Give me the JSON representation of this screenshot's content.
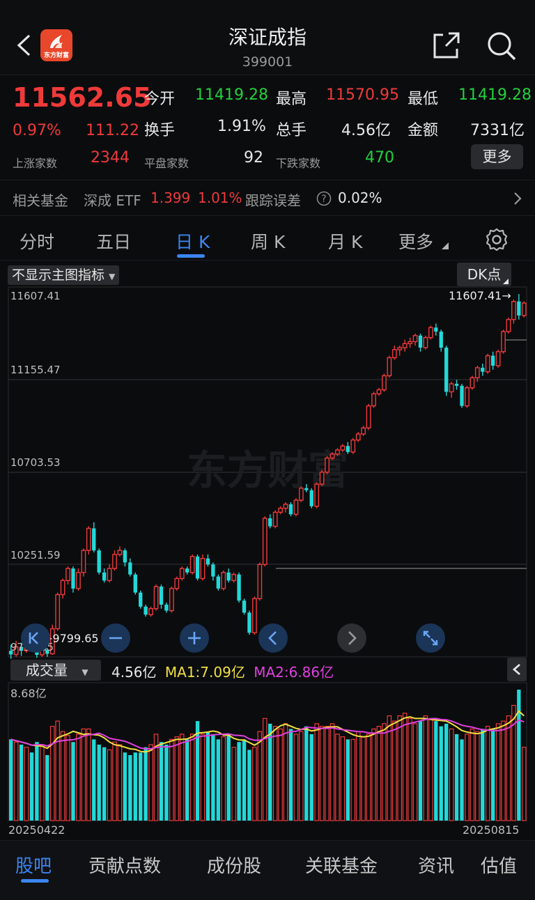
{
  "header": {
    "title": "深证成指",
    "code": "399001",
    "logo_text": "东方财富"
  },
  "quote": {
    "price": "11562.65",
    "change_pct": "0.97%",
    "change_abs": "111.22",
    "open_label": "今开",
    "open": "11419.28",
    "high_label": "最高",
    "high": "11570.95",
    "low_label": "最低",
    "low": "11419.28",
    "turnover_label": "换手",
    "turnover": "1.91%",
    "volume_label": "总手",
    "volume": "4.56亿",
    "amount_label": "金额",
    "amount": "7331亿",
    "up_label": "上涨家数",
    "up": "2344",
    "flat_label": "平盘家数",
    "flat": "92",
    "down_label": "下跌家数",
    "down": "470",
    "more_label": "更多"
  },
  "fund": {
    "label": "相关基金",
    "name": "深成 ETF",
    "price": "1.399",
    "pct": "1.01%",
    "error_label": "跟踪误差",
    "error": "0.02%"
  },
  "tabs": [
    {
      "label": "分时"
    },
    {
      "label": "五日"
    },
    {
      "label": "日 K"
    },
    {
      "label": "周 K"
    },
    {
      "label": "月 K"
    },
    {
      "label": "更多"
    }
  ],
  "chart": {
    "indicator_dropdown": "不显示主图指标",
    "dk_button": "DK点",
    "watermark": "东方财富",
    "y_labels": [
      "11607.41",
      "11155.47",
      "10703.53",
      "10251.59",
      "9799.65"
    ],
    "max_marker": "11607.41",
    "min_marker": "9799.65"
  },
  "volume": {
    "dropdown": "成交量",
    "value": "4.56亿",
    "ma1": "MA1:7.09亿",
    "ma2": "MA2:6.86亿",
    "max_label": "8.68亿",
    "start_date": "20250422",
    "end_date": "20250815"
  },
  "bottom_nav": [
    {
      "label": "股吧"
    },
    {
      "label": "贡献点数"
    },
    {
      "label": "成份股"
    },
    {
      "label": "关联基金"
    },
    {
      "label": "资讯"
    },
    {
      "label": "估值"
    }
  ],
  "colors": {
    "up": "#f03a3a",
    "down": "#23d8d8",
    "accent": "#3a86f0",
    "ma1": "#f0e040",
    "ma2": "#e040e0"
  },
  "chart_data": {
    "type": "candlestick",
    "y_range": [
      9799.65,
      11607.41
    ],
    "candles": [
      [
        9830,
        9812,
        9860,
        9790
      ],
      [
        9812,
        9850,
        9880,
        9800
      ],
      [
        9850,
        9830,
        9870,
        9805
      ],
      [
        9830,
        9900,
        9915,
        9820
      ],
      [
        9900,
        9860,
        9920,
        9840
      ],
      [
        9860,
        9810,
        9880,
        9795
      ],
      [
        9810,
        9835,
        9850,
        9800
      ],
      [
        9835,
        9815,
        9845,
        9800
      ],
      [
        9815,
        9940,
        9960,
        9810
      ],
      [
        9940,
        10110,
        10120,
        9930
      ],
      [
        10110,
        10180,
        10190,
        10090
      ],
      [
        10180,
        10240,
        10250,
        10160
      ],
      [
        10240,
        10140,
        10250,
        10120
      ],
      [
        10140,
        10220,
        10240,
        10130
      ],
      [
        10220,
        10330,
        10340,
        10200
      ],
      [
        10330,
        10440,
        10450,
        10310
      ],
      [
        10440,
        10330,
        10470,
        10320
      ],
      [
        10330,
        10220,
        10340,
        10210
      ],
      [
        10220,
        10180,
        10240,
        10170
      ],
      [
        10180,
        10240,
        10260,
        10170
      ],
      [
        10240,
        10310,
        10330,
        10230
      ],
      [
        10310,
        10330,
        10350,
        10300
      ],
      [
        10330,
        10270,
        10340,
        10250
      ],
      [
        10270,
        10210,
        10290,
        10200
      ],
      [
        10210,
        10120,
        10220,
        10110
      ],
      [
        10120,
        10050,
        10130,
        10040
      ],
      [
        10050,
        10010,
        10060,
        10000
      ],
      [
        10010,
        10040,
        10050,
        10000
      ],
      [
        10040,
        10150,
        10160,
        10030
      ],
      [
        10150,
        10060,
        10160,
        10040
      ],
      [
        10060,
        10030,
        10070,
        10020
      ],
      [
        10030,
        10140,
        10150,
        10020
      ],
      [
        10140,
        10190,
        10200,
        10130
      ],
      [
        10190,
        10240,
        10250,
        10180
      ],
      [
        10240,
        10220,
        10250,
        10210
      ],
      [
        10220,
        10300,
        10310,
        10210
      ],
      [
        10300,
        10190,
        10310,
        10180
      ],
      [
        10190,
        10290,
        10310,
        10180
      ],
      [
        10290,
        10260,
        10310,
        10250
      ],
      [
        10260,
        10200,
        10270,
        10180
      ],
      [
        10200,
        10140,
        10210,
        10130
      ],
      [
        10140,
        10220,
        10230,
        10130
      ],
      [
        10220,
        10180,
        10240,
        10170
      ],
      [
        10180,
        10210,
        10220,
        10170
      ],
      [
        10210,
        10080,
        10220,
        10070
      ],
      [
        10080,
        10020,
        10090,
        10010
      ],
      [
        10020,
        9920,
        10030,
        9910
      ],
      [
        9920,
        10090,
        10100,
        9910
      ],
      [
        10090,
        10260,
        10270,
        10080
      ],
      [
        10260,
        10490,
        10500,
        10250
      ],
      [
        10490,
        10450,
        10510,
        10440
      ],
      [
        10450,
        10520,
        10530,
        10440
      ],
      [
        10520,
        10540,
        10550,
        10510
      ],
      [
        10540,
        10560,
        10570,
        10520
      ],
      [
        10560,
        10510,
        10570,
        10500
      ],
      [
        10510,
        10580,
        10590,
        10500
      ],
      [
        10580,
        10640,
        10650,
        10570
      ],
      [
        10640,
        10630,
        10660,
        10620
      ],
      [
        10630,
        10550,
        10640,
        10540
      ],
      [
        10550,
        10660,
        10670,
        10540
      ],
      [
        10660,
        10720,
        10730,
        10650
      ],
      [
        10720,
        10790,
        10800,
        10710
      ],
      [
        10790,
        10810,
        10820,
        10780
      ],
      [
        10810,
        10830,
        10840,
        10800
      ],
      [
        10830,
        10850,
        10860,
        10820
      ],
      [
        10850,
        10820,
        10870,
        10810
      ],
      [
        10820,
        10880,
        10890,
        10810
      ],
      [
        10880,
        10910,
        10920,
        10870
      ],
      [
        10910,
        10940,
        10950,
        10900
      ],
      [
        10940,
        11050,
        11060,
        10930
      ],
      [
        11050,
        11110,
        11120,
        11040
      ],
      [
        11110,
        11130,
        11140,
        11100
      ],
      [
        11130,
        11200,
        11210,
        11120
      ],
      [
        11200,
        11290,
        11300,
        11190
      ],
      [
        11290,
        11330,
        11350,
        11280
      ],
      [
        11330,
        11340,
        11350,
        11300
      ],
      [
        11340,
        11360,
        11380,
        11320
      ],
      [
        11360,
        11370,
        11390,
        11340
      ],
      [
        11370,
        11400,
        11410,
        11350
      ],
      [
        11400,
        11340,
        11410,
        11320
      ],
      [
        11340,
        11390,
        11400,
        11330
      ],
      [
        11390,
        11440,
        11450,
        11380
      ],
      [
        11440,
        11420,
        11460,
        11400
      ],
      [
        11420,
        11340,
        11430,
        11320
      ],
      [
        11340,
        11120,
        11350,
        11100
      ],
      [
        11120,
        11160,
        11170,
        11090
      ],
      [
        11160,
        11150,
        11180,
        11130
      ],
      [
        11150,
        11050,
        11160,
        11040
      ],
      [
        11050,
        11140,
        11150,
        11040
      ],
      [
        11140,
        11190,
        11200,
        11130
      ],
      [
        11190,
        11240,
        11250,
        11170
      ],
      [
        11240,
        11220,
        11260,
        11200
      ],
      [
        11220,
        11300,
        11310,
        11210
      ],
      [
        11300,
        11250,
        11320,
        11230
      ],
      [
        11250,
        11320,
        11330,
        11240
      ],
      [
        11320,
        11420,
        11430,
        11310
      ],
      [
        11420,
        11480,
        11490,
        11410
      ],
      [
        11480,
        11570,
        11580,
        11460
      ],
      [
        11570,
        11500,
        11607,
        11480
      ],
      [
        11500,
        11562,
        11571,
        11490
      ]
    ],
    "volume_ratio": [
      0.62,
      0.6,
      0.58,
      0.56,
      0.52,
      0.6,
      0.58,
      0.5,
      0.72,
      0.76,
      0.68,
      0.65,
      0.6,
      0.66,
      0.7,
      0.7,
      0.62,
      0.58,
      0.56,
      0.54,
      0.6,
      0.58,
      0.52,
      0.5,
      0.52,
      0.52,
      0.56,
      0.58,
      0.66,
      0.6,
      0.58,
      0.62,
      0.64,
      0.66,
      0.62,
      0.66,
      0.76,
      0.66,
      0.68,
      0.66,
      0.62,
      0.64,
      0.66,
      0.56,
      0.6,
      0.62,
      0.54,
      0.56,
      0.68,
      0.78,
      0.74,
      0.72,
      0.7,
      0.74,
      0.7,
      0.66,
      0.68,
      0.72,
      0.66,
      0.74,
      0.72,
      0.72,
      0.74,
      0.66,
      0.64,
      0.62,
      0.62,
      0.68,
      0.64,
      0.66,
      0.7,
      0.72,
      0.74,
      0.8,
      0.76,
      0.8,
      0.82,
      0.78,
      0.74,
      0.76,
      0.8,
      0.78,
      0.76,
      0.72,
      0.74,
      0.7,
      0.66,
      0.62,
      0.66,
      0.7,
      0.68,
      0.7,
      0.72,
      0.7,
      0.74,
      0.76,
      0.8,
      0.88,
      1.0,
      0.56
    ]
  }
}
